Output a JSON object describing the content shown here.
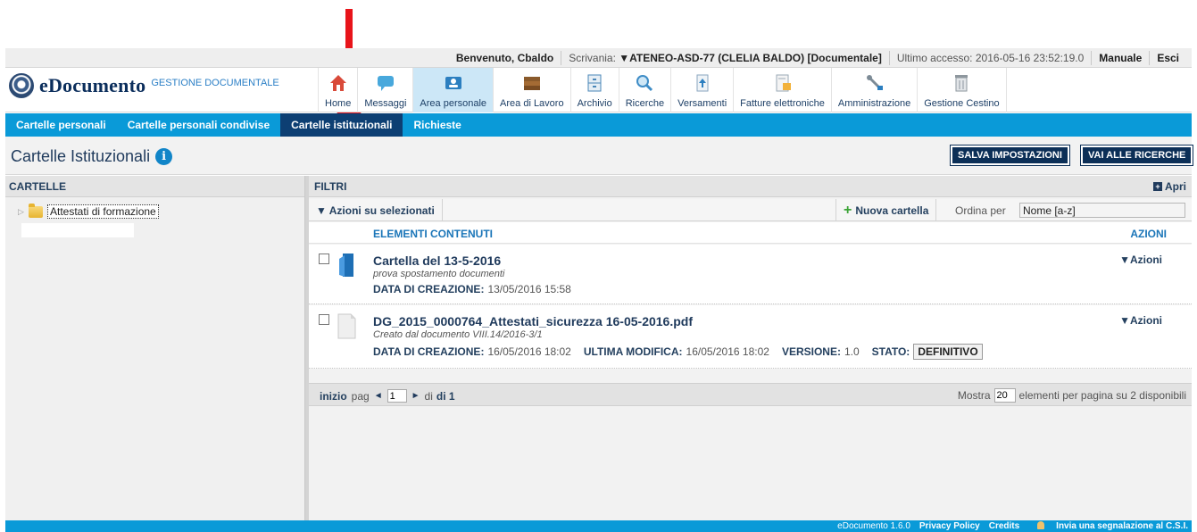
{
  "topbar": {
    "welcome": "Benvenuto, Cbaldo",
    "scrivania_label": "Scrivania:",
    "scrivania_value": "▼ATENEO-ASD-77 (CLELIA BALDO) [Documentale]",
    "last_access": "Ultimo accesso: 2016-05-16 23:52:19.0",
    "manual": "Manuale",
    "exit": "Esci"
  },
  "logo": {
    "name": "eDocumento",
    "subtitle": "GESTIONE DOCUMENTALE"
  },
  "modules": [
    {
      "label": "Home",
      "icon": "home-icon"
    },
    {
      "label": "Messaggi",
      "icon": "chat-bubble-icon"
    },
    {
      "label": "Area personale",
      "icon": "user-card-icon"
    },
    {
      "label": "Area di Lavoro",
      "icon": "books-icon"
    },
    {
      "label": "Archivio",
      "icon": "cabinet-icon"
    },
    {
      "label": "Ricerche",
      "icon": "magnifier-icon"
    },
    {
      "label": "Versamenti",
      "icon": "upload-doc-icon"
    },
    {
      "label": "Fatture elettroniche",
      "icon": "invoice-icon"
    },
    {
      "label": "Amministrazione",
      "icon": "wrench-icon"
    },
    {
      "label": "Gestione Cestino",
      "icon": "trash-icon"
    }
  ],
  "colors": {
    "accent": "#0a9ad8",
    "navy": "#0c2f57",
    "active_module": "#cce7f7",
    "annotation_arrow": "#e8141a"
  },
  "subnav": [
    {
      "label": "Cartelle personali"
    },
    {
      "label": "Cartelle personali condivise"
    },
    {
      "label": "Cartelle istituzionali"
    },
    {
      "label": "Richieste"
    }
  ],
  "page": {
    "title": "Cartelle Istituzionali",
    "save_settings": "SALVA IMPOSTAZIONI",
    "go_to_search": "VAI ALLE RICERCHE"
  },
  "left": {
    "header": "CARTELLE",
    "tree_item": "Attestati di formazione"
  },
  "right": {
    "filters": "FILTRI",
    "open": "Apri",
    "actions_selected": "▼ Azioni su selezionati",
    "new_folder": "Nuova cartella",
    "order_label": "Ordina per",
    "order_value": "Nome [a-z]",
    "col_elements": "ELEMENTI CONTENUTI",
    "col_actions": "AZIONI"
  },
  "items": [
    {
      "title": "Cartella del 13-5-2016",
      "subtitle": "prova spostamento documenti",
      "created_label": "DATA DI CREAZIONE:",
      "created_value": "13/05/2016 15:58",
      "actions": "▼Azioni"
    },
    {
      "title": "DG_2015_0000764_Attestati_sicurezza 16-05-2016.pdf",
      "subtitle": "Creato dal documento VIII.14/2016-3/1",
      "created_label": "DATA DI CREAZIONE:",
      "created_value": "16/05/2016 18:02",
      "modified_label": "ULTIMA MODIFICA:",
      "modified_value": "16/05/2016 18:02",
      "version_label": "VERSIONE:",
      "version_value": "1.0",
      "state_label": "STATO:",
      "state_value": "DEFINITIVO",
      "actions": "▼Azioni"
    }
  ],
  "pager": {
    "start": "inizio",
    "pag": "pag",
    "prev": "◄",
    "page_value": "1",
    "next": "►",
    "of": "di",
    "of_total": "di 1",
    "show": "Mostra",
    "per_page_value": "20",
    "per_page_text": "elementi per pagina su 2 disponibili"
  },
  "footer": {
    "version": "eDocumento 1.6.0",
    "privacy": "Privacy Policy",
    "credits": "Credits",
    "report": "Invia una segnalazione al C.S.I."
  }
}
